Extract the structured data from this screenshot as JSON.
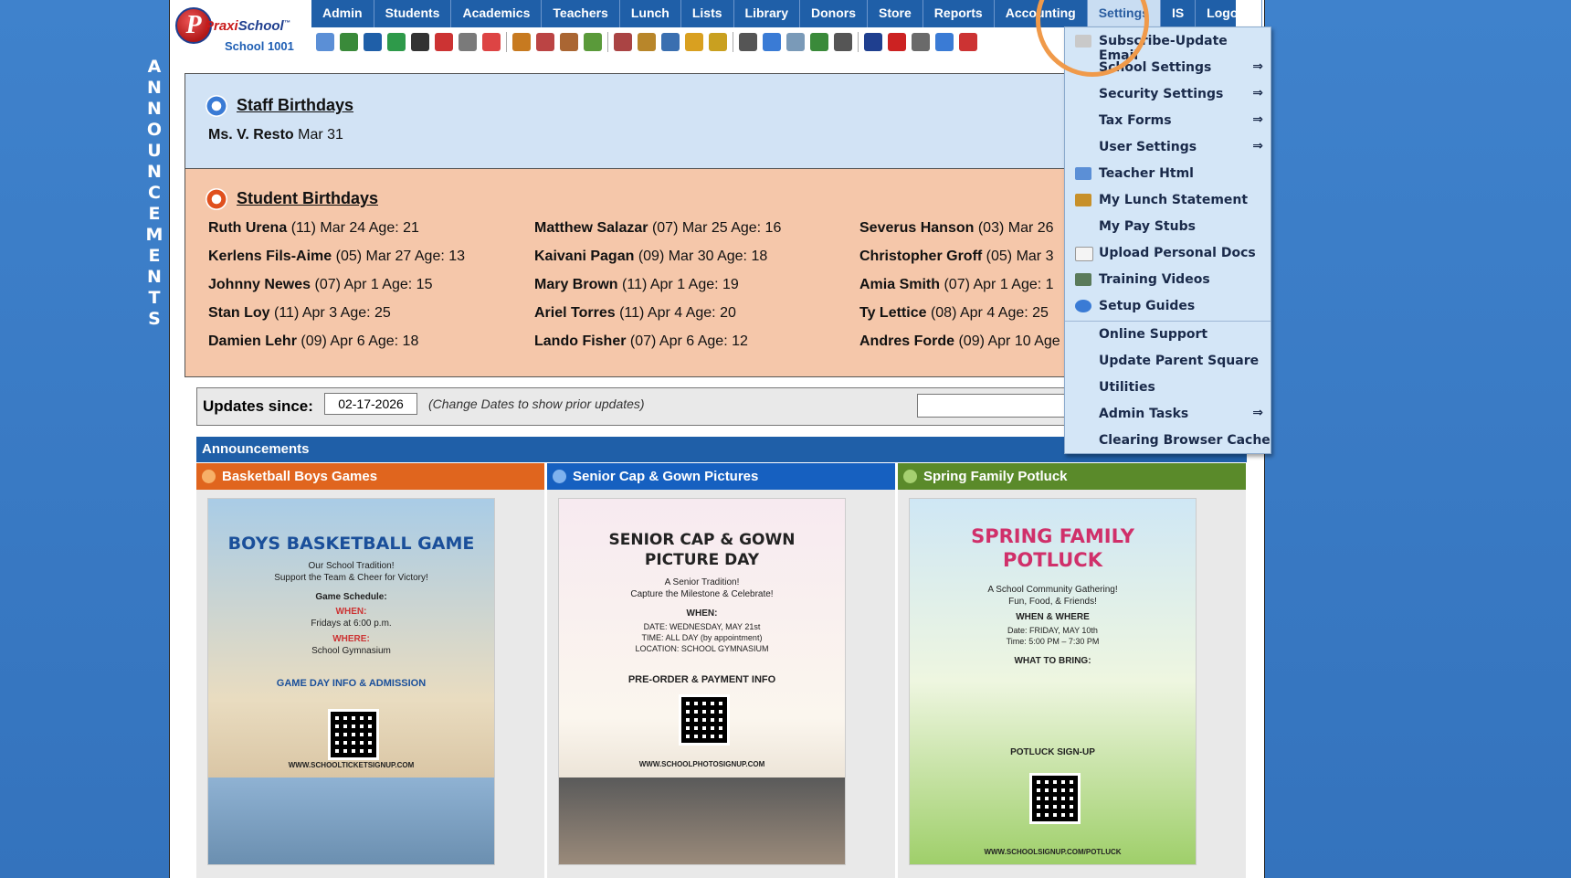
{
  "colors": {
    "page_bg": "#3a7cc7",
    "nav_bg": "#1f5fa8",
    "staff_bg": "#d2e3f5",
    "student_bg": "#f5c7aa",
    "dropdown_bg": "#d4e6f7",
    "highlight": "#f09a4a",
    "ann_orange": "#e0651e",
    "ann_blue": "#1660c0",
    "ann_green": "#5a8a2a"
  },
  "side_banner": [
    "A",
    "N",
    "N",
    "O",
    "U",
    "N",
    "C",
    "E",
    "M",
    "E",
    "N",
    "T",
    "S"
  ],
  "logo": {
    "mark": "P",
    "brand_a": "Praxi",
    "brand_b": "School",
    "tm": "™",
    "school": "School 1001"
  },
  "nav": {
    "items": [
      "Admin",
      "Students",
      "Academics",
      "Teachers",
      "Lunch",
      "Lists",
      "Library",
      "Donors",
      "Store",
      "Reports",
      "Accounting",
      "Settings",
      "IS",
      "Logout"
    ],
    "active": "Settings"
  },
  "toolbar_icons": [
    "search-icon",
    "calendar-icon",
    "email-icon",
    "chat-icon",
    "phone-icon",
    "speaker-icon",
    "schedule-icon",
    "calendar-day-icon",
    "megaphone-icon",
    "user-add-icon",
    "user-icon",
    "money-icon",
    "group-icon",
    "lunch-icon",
    "book-icon",
    "tag-icon",
    "forward-icon",
    "staff-icon",
    "clock-icon",
    "grid-icon",
    "cash-icon",
    "printer-icon",
    "ap-icon",
    "pdf-icon",
    "stack-icon",
    "help-icon",
    "power-icon"
  ],
  "staff_birthdays": {
    "title": "Staff Birthdays",
    "entries": [
      {
        "name": "Ms. V. Resto",
        "date": "Mar 31"
      }
    ]
  },
  "student_birthdays": {
    "title": "Student Birthdays",
    "columns": [
      [
        {
          "name": "Ruth Urena",
          "detail": "(11) Mar 24 Age: 21"
        },
        {
          "name": "Kerlens Fils-Aime",
          "detail": "(05) Mar 27 Age: 13"
        },
        {
          "name": "Johnny Newes",
          "detail": "(07) Apr 1 Age: 15"
        },
        {
          "name": "Stan Loy",
          "detail": "(11) Apr 3 Age: 25"
        },
        {
          "name": "Damien Lehr",
          "detail": "(09) Apr 6 Age: 18"
        }
      ],
      [
        {
          "name": "Matthew Salazar",
          "detail": "(07) Mar 25 Age: 16"
        },
        {
          "name": "Kaivani Pagan",
          "detail": "(09) Mar 30 Age: 18"
        },
        {
          "name": "Mary Brown",
          "detail": "(11) Apr 1 Age: 19"
        },
        {
          "name": "Ariel Torres",
          "detail": "(11) Apr 4 Age: 20"
        },
        {
          "name": "Lando Fisher",
          "detail": "(07) Apr 6 Age: 12"
        }
      ],
      [
        {
          "name": "Severus Hanson",
          "detail": "(03) Mar 26"
        },
        {
          "name": "Christopher Groff",
          "detail": "(05) Mar 3"
        },
        {
          "name": "Amia Smith",
          "detail": "(07) Apr 1 Age: 1"
        },
        {
          "name": "Ty Lettice",
          "detail": "(08) Apr 4 Age: 25"
        },
        {
          "name": "Andres Forde",
          "detail": "(09) Apr 10 Age"
        }
      ]
    ]
  },
  "updates": {
    "label": "Updates since:",
    "date_value": "02-17-2026",
    "note": "(Change Dates to show prior updates)"
  },
  "announcements": {
    "header": "Announcements",
    "cards": [
      {
        "title": "Basketball Boys Games",
        "poster_title": "BOYS BASKETBALL GAME",
        "lines": [
          "Our School Tradition!",
          "Support the Team & Cheer for Victory!",
          "Game Schedule:",
          "WHEN:",
          "Fridays at 6:00 p.m.",
          "WHERE:",
          "School Gymnasium",
          "GAME DAY INFO & ADMISSION",
          "WWW.SCHOOLTICKETSIGNUP.COM"
        ]
      },
      {
        "title": "Senior Cap & Gown Pictures",
        "poster_title": "SENIOR CAP & GOWN PICTURE DAY",
        "lines": [
          "A Senior Tradition!",
          "Capture the Milestone & Celebrate!",
          "WHEN:",
          "DATE: WEDNESDAY, MAY 21st",
          "TIME: ALL DAY (by appointment)",
          "LOCATION: SCHOOL GYMNASIUM",
          "PRE-ORDER & PAYMENT INFO",
          "WWW.SCHOOLPHOTOSIGNUP.COM"
        ]
      },
      {
        "title": "Spring Family Potluck",
        "poster_title": "SPRING FAMILY POTLUCK",
        "lines": [
          "A School Community Gathering!",
          "Fun, Food, & Friends!",
          "WHEN & WHERE",
          "Date: FRIDAY, MAY 10th",
          "Time: 5:00 PM – 7:30 PM",
          "WHAT TO BRING:",
          "POTLUCK SIGN-UP",
          "WWW.SCHOOLSIGNUP.COM/POTLUCK"
        ]
      }
    ]
  },
  "settings_menu": {
    "items": [
      {
        "label": "Subscribe-Update Email",
        "icon": "envelope-icon",
        "submenu": false
      },
      {
        "label": "School Settings",
        "icon": "",
        "submenu": true
      },
      {
        "label": "Security Settings",
        "icon": "",
        "submenu": true
      },
      {
        "label": "Tax Forms",
        "icon": "",
        "submenu": true
      },
      {
        "label": "User Settings",
        "icon": "",
        "submenu": true
      },
      {
        "label": "Teacher Html",
        "icon": "html-icon",
        "submenu": false
      },
      {
        "label": "My Lunch Statement",
        "icon": "burger-icon",
        "submenu": false
      },
      {
        "label": "My Pay Stubs",
        "icon": "",
        "submenu": false
      },
      {
        "label": "Upload Personal Docs",
        "icon": "document-icon",
        "submenu": false
      },
      {
        "label": "Training Videos",
        "icon": "film-icon",
        "submenu": false
      },
      {
        "label": "Setup Guides",
        "icon": "help-icon",
        "submenu": false
      },
      {
        "label": "Online Support",
        "icon": "",
        "submenu": false
      },
      {
        "label": "Update Parent Square",
        "icon": "",
        "submenu": false
      },
      {
        "label": "Utilities",
        "icon": "",
        "submenu": false
      },
      {
        "label": "Admin Tasks",
        "icon": "",
        "submenu": true
      },
      {
        "label": "Clearing Browser Cache",
        "icon": "",
        "submenu": false
      }
    ],
    "arrow": "⇒"
  }
}
